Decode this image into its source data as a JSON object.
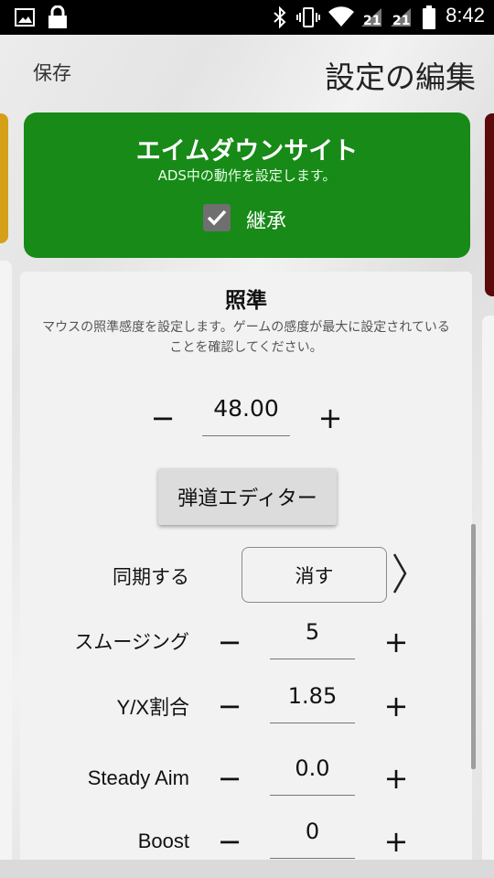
{
  "status_bar": {
    "time": "8:42",
    "icons": [
      "image-icon",
      "lock-icon",
      "bluetooth-icon",
      "vibrate-icon",
      "wifi-icon",
      "sim-icon",
      "sim-icon",
      "battery-icon"
    ],
    "sim1": "21",
    "sim2": "21"
  },
  "header": {
    "save_label": "保存",
    "title": "設定の編集"
  },
  "ads_card": {
    "title": "エイムダウンサイト",
    "subtitle": "ADS中の動作を設定します。",
    "inherit_label": "継承",
    "inherit_checked": true,
    "color": "#178a17"
  },
  "aim_section": {
    "title": "照準",
    "description": "マウスの照準感度を設定します。ゲームの感度が最大に設定されていることを確認してください。",
    "sensitivity": {
      "value": "48.00",
      "minus": "−",
      "plus": "+"
    }
  },
  "ballistic_button": "弾道エディター",
  "rows": {
    "sync": {
      "label": "同期する",
      "value": "消す"
    },
    "smoothing": {
      "label": "スムージング",
      "value": "5",
      "minus": "−",
      "plus": "+"
    },
    "yx_ratio": {
      "label": "Y/X割合",
      "value": "1.85",
      "minus": "−",
      "plus": "+"
    },
    "steady_aim": {
      "label": "Steady Aim",
      "value": "0.0",
      "minus": "−",
      "plus": "+"
    },
    "boost": {
      "label": "Boost",
      "value": "0",
      "minus": "−",
      "plus": "+"
    }
  }
}
